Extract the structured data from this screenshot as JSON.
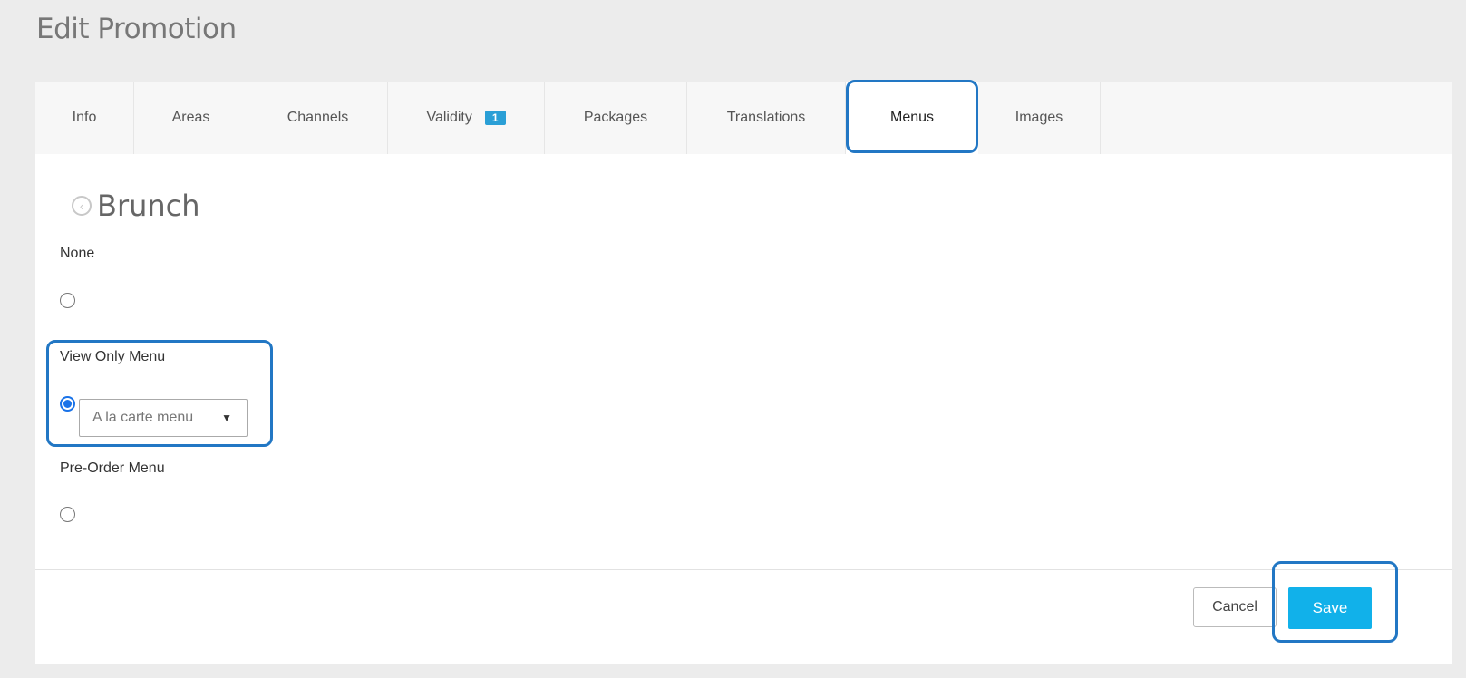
{
  "page": {
    "title": "Edit Promotion"
  },
  "tabs": [
    {
      "label": "Info"
    },
    {
      "label": "Areas"
    },
    {
      "label": "Channels"
    },
    {
      "label": "Validity",
      "badge": "1"
    },
    {
      "label": "Packages"
    },
    {
      "label": "Translations"
    },
    {
      "label": "Menus",
      "active": true
    },
    {
      "label": "Images"
    }
  ],
  "section": {
    "title": "Brunch",
    "back_icon": "circle-chevron-left-icon"
  },
  "options": [
    {
      "label": "None",
      "selected": false
    },
    {
      "label": "View Only Menu",
      "selected": true,
      "select_value": "A la carte menu"
    },
    {
      "label": "Pre-Order Menu",
      "selected": false
    }
  ],
  "footer": {
    "cancel_label": "Cancel",
    "save_label": "Save"
  },
  "colors": {
    "accent": "#11b1ea",
    "highlight": "#2277c4",
    "badge": "#2a9fd6"
  }
}
